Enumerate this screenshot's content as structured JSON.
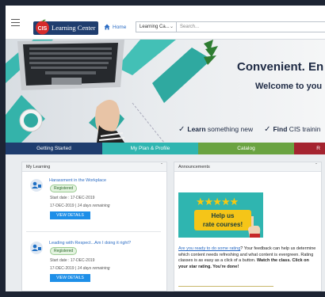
{
  "header": {
    "logo_text": "Learning Center",
    "home_label": "Home",
    "search_scope": "Learning Ca...",
    "search_placeholder": "Search..."
  },
  "hero": {
    "title": "Convenient. En",
    "subtitle": "Welcome to you",
    "bullet1_bold": "Learn",
    "bullet1_rest": " something new",
    "bullet2_bold": "Find",
    "bullet2_rest": " CIS trainin"
  },
  "tabs": [
    {
      "label": "Getting Started",
      "color": "#1f3d6e"
    },
    {
      "label": "My Plan & Profile",
      "color": "#2fb5b0"
    },
    {
      "label": "Catalog",
      "color": "#6aa341"
    },
    {
      "label": "R",
      "color": "#a4232f"
    }
  ],
  "my_learning": {
    "title": "My Learning",
    "courses": [
      {
        "title": "Harassment in the Workplace",
        "status": "Registered",
        "start": "Start date : 17-DEC-2019",
        "due": "17-DEC-2019",
        "remaining": "14 days remaining",
        "button": "VIEW DETAILS"
      },
      {
        "title": "Leading with Respect...Am I doing it right?",
        "status": "Registered",
        "start": "Start date : 17-DEC-2019",
        "due": "17-DEC-2019",
        "remaining": "14 days remaining",
        "button": "VIEW DETAILS"
      }
    ]
  },
  "announcements": {
    "title": "Announcements",
    "image_line1": "Help us",
    "image_line2": "rate courses!",
    "link_text": "Are you ready to do some rating",
    "body": "? Your feedback can help us determine which content needs refreshing and what content is evergreen. Rating classes is as easy as a click of a button. ",
    "bold_text": "Watch the class. Click on your star rating. You're done!"
  }
}
